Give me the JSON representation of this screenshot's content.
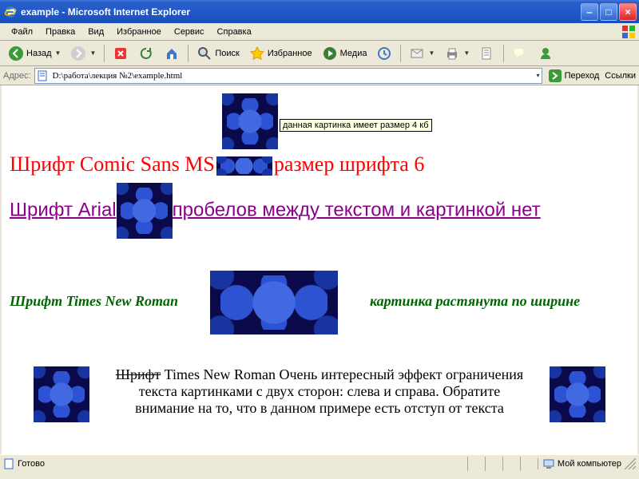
{
  "window": {
    "title": "example - Microsoft Internet Explorer"
  },
  "menu": {
    "file": "Файл",
    "edit": "Правка",
    "view": "Вид",
    "favorites": "Избранное",
    "tools": "Сервис",
    "help": "Справка"
  },
  "toolbar": {
    "back": "Назад",
    "search": "Поиск",
    "favorites": "Избранное",
    "media": "Медиа"
  },
  "addressbar": {
    "label": "Адрес:",
    "url": "D:\\работа\\лекция №2\\example.html",
    "go": "Переход",
    "links": "Ссылки"
  },
  "page": {
    "tooltip": "данная картинка имеет размер 4 кб",
    "comic1": "Шрифт Comic Sans MS",
    "comic2": "размер шрифта 6",
    "arial1": "Шрифт Arial",
    "arial2": "пробелов между текстом и картинкой нет",
    "roman1": "Шрифт Times New Roman",
    "roman2": "картинка растянута по ширине",
    "para_strike": "Шрифт",
    "para_rest": " Times New Roman Очень интересный эффект ограничения текста картинками с двух сторон: слева и справа. Обратите внимание на то, что в данном примере есть отступ от текста"
  },
  "status": {
    "ready": "Готово",
    "zone": "Мой компьютер"
  }
}
